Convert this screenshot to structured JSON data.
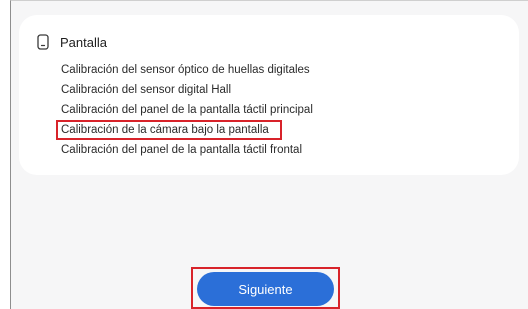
{
  "section": {
    "title": "Pantalla",
    "icon": "phone-icon"
  },
  "items": [
    {
      "label": "Calibración del sensor óptico de huellas digitales"
    },
    {
      "label": "Calibración del sensor digital Hall"
    },
    {
      "label": "Calibración del panel de la pantalla táctil principal"
    },
    {
      "label": "Calibración de la cámara bajo la pantalla",
      "highlighted": true
    },
    {
      "label": "Calibración del panel de la pantalla táctil frontal"
    }
  ],
  "footer": {
    "next_label": "Siguiente"
  },
  "colors": {
    "accent": "#2b6fd8",
    "highlight": "#d8232a",
    "background": "#f6f6f7"
  }
}
